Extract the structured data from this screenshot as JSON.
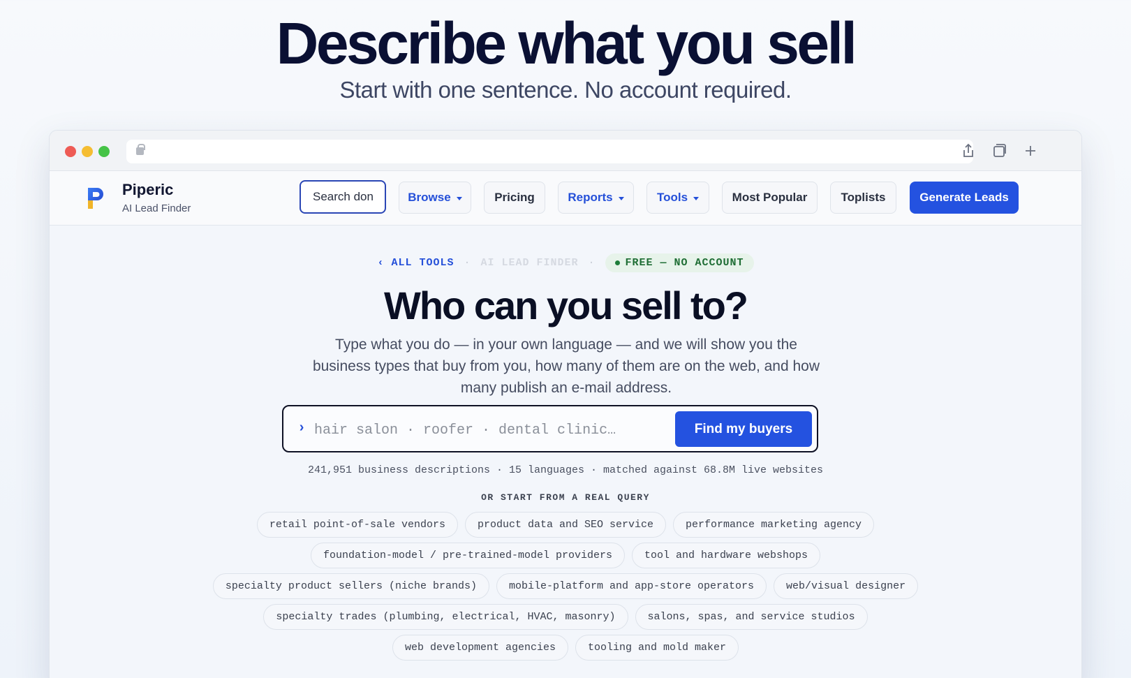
{
  "hero": {
    "title": "Describe what you sell",
    "subtitle": "Start with one sentence. No account required."
  },
  "browser": {
    "icons": [
      "lock-icon",
      "share-icon",
      "tabs-icon",
      "new-tab-icon"
    ]
  },
  "nav": {
    "brand_name": "Piperic",
    "brand_sub": "AI Lead Finder",
    "search_value": "Search don",
    "items": [
      {
        "label": "Browse",
        "dropdown": true
      },
      {
        "label": "Pricing",
        "dropdown": false
      },
      {
        "label": "Reports",
        "dropdown": true
      },
      {
        "label": "Tools",
        "dropdown": true
      },
      {
        "label": "Most Popular",
        "dropdown": false
      },
      {
        "label": "Toplists",
        "dropdown": false
      }
    ],
    "cta": "Generate Leads"
  },
  "main": {
    "breadcrumb": {
      "back": "‹ ALL TOOLS",
      "current": "AI LEAD FINDER",
      "badge": "FREE — NO ACCOUNT"
    },
    "title": "Who can you sell to?",
    "description": "Type what you do — in your own language — and we will show you the business types that buy from you, how many of them are on the web, and how many publish an e-mail address.",
    "search": {
      "prompt": "›",
      "placeholder": "hair salon · roofer · dental clinic…",
      "button": "Find my buyers"
    },
    "stats": "241,951 business descriptions · 15 languages · matched against 68.8M live websites",
    "or_start": "OR START FROM A REAL QUERY",
    "chip_rows": [
      [
        "retail point-of-sale vendors",
        "product data and SEO service",
        "performance marketing agency"
      ],
      [
        "foundation-model / pre-trained-model providers",
        "tool and hardware webshops"
      ],
      [
        "specialty product sellers (niche brands)",
        "mobile-platform and app-store operators",
        "web/visual designer"
      ],
      [
        "specialty trades (plumbing, electrical, HVAC, masonry)",
        "salons, spas, and service studios"
      ],
      [
        "web development agencies",
        "tooling and mold maker"
      ]
    ]
  },
  "colors": {
    "accent": "#2452e0",
    "badge_bg": "#e7f3ea",
    "badge_text": "#1e6d34"
  }
}
